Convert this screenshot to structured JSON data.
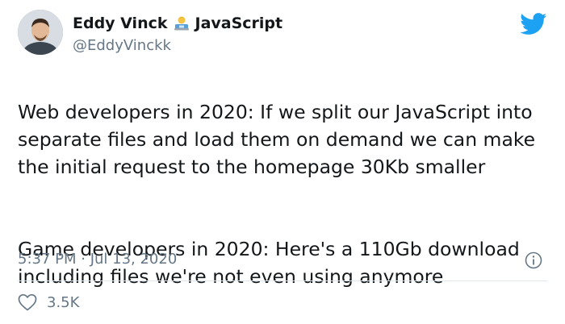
{
  "author": {
    "display_name": "Eddy Vinck",
    "emoji_icon": "technologist-emoji-icon",
    "label": "JavaScript",
    "handle": "@EddyVinckk"
  },
  "tweet": {
    "paragraphs": [
      "Web developers in 2020: If we split our JavaScript into separate files and load them on demand we can make the initial request to the homepage 30Kb smaller",
      "Game developers in 2020: Here's a 110Gb download including files we're not even using anymore"
    ],
    "timestamp": "5:37 PM · Jul 13, 2020"
  },
  "engagement": {
    "likes": "3.5K"
  },
  "icons": {
    "bird": "twitter-bird-icon",
    "info": "info-icon",
    "heart": "heart-icon"
  },
  "colors": {
    "twitter_blue": "#1da1f2",
    "secondary_text": "#657786",
    "primary_text": "#14171a"
  }
}
